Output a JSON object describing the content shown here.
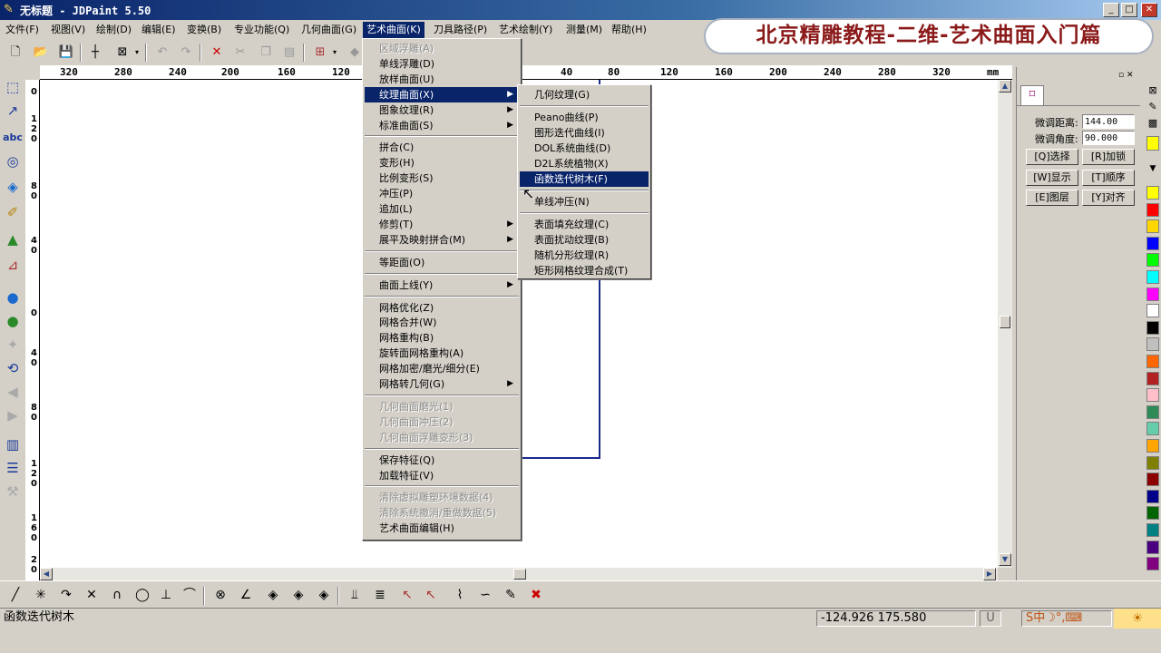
{
  "window": {
    "title": "无标题 - JDPaint 5.50",
    "buttons": {
      "minimize": "_",
      "maximize": "□",
      "close": "✕"
    }
  },
  "menubar": [
    "文件(F)",
    "视图(V)",
    "绘制(D)",
    "编辑(E)",
    "变换(B)",
    "专业功能(Q)",
    "几何曲面(G)",
    "艺术曲面(K)",
    "刀具路径(P)",
    "艺术绘制(Y)",
    "测量(M)",
    "帮助(H)"
  ],
  "banner": "北京精雕教程-二维-艺术曲面入门篇",
  "hruler_labels": [
    "320",
    "280",
    "240",
    "200",
    "160",
    "120",
    "40",
    "80",
    "120",
    "160",
    "200",
    "240",
    "280",
    "320",
    "mm"
  ],
  "vruler_labels": [
    "0",
    "1\n2\n0",
    "8\n0",
    "4\n0",
    "0",
    "4\n0",
    "8\n0",
    "1\n2\n0",
    "1\n6\n0",
    "2\n0"
  ],
  "art_menu": {
    "items": [
      {
        "label": "区域浮雕(A)",
        "disabled": true
      },
      {
        "label": "单线浮雕(D)"
      },
      {
        "label": "放样曲面(U)"
      },
      {
        "label": "纹理曲面(X)",
        "submenu": true,
        "highlight": true
      },
      {
        "label": "图象纹理(R)",
        "submenu": true
      },
      {
        "label": "标准曲面(S)",
        "submenu": true
      },
      {
        "sep": true
      },
      {
        "label": "拼合(C)"
      },
      {
        "label": "变形(H)"
      },
      {
        "label": "比例变形(S)"
      },
      {
        "label": "冲压(P)"
      },
      {
        "label": "追加(L)"
      },
      {
        "label": "修剪(T)",
        "submenu": true
      },
      {
        "label": "展平及映射拼合(M)",
        "submenu": true
      },
      {
        "sep": true
      },
      {
        "label": "等距面(O)"
      },
      {
        "sep": true
      },
      {
        "label": "曲面上线(Y)",
        "submenu": true
      },
      {
        "sep": true
      },
      {
        "label": "网格优化(Z)"
      },
      {
        "label": "网格合并(W)"
      },
      {
        "label": "网格重构(B)"
      },
      {
        "label": "旋转面网格重构(A)"
      },
      {
        "label": "网格加密/磨光/细分(E)"
      },
      {
        "label": "网格转几何(G)",
        "submenu": true
      },
      {
        "sep": true
      },
      {
        "label": "几何曲面磨光(1)",
        "disabled": true
      },
      {
        "label": "几何曲面冲压(2)",
        "disabled": true
      },
      {
        "label": "几何曲面浮雕变形(3)",
        "disabled": true
      },
      {
        "sep": true
      },
      {
        "label": "保存特征(Q)"
      },
      {
        "label": "加载特征(V)"
      },
      {
        "sep": true
      },
      {
        "label": "清除虚拟雕塑环境数据(4)",
        "disabled": true
      },
      {
        "label": "清除系统撤消/重做数据(5)",
        "disabled": true
      },
      {
        "label": "艺术曲面编辑(H)"
      }
    ]
  },
  "texture_submenu": {
    "items": [
      {
        "label": "几何纹理(G)"
      },
      {
        "sep": true
      },
      {
        "label": "Peano曲线(P)"
      },
      {
        "label": "图形迭代曲线(I)"
      },
      {
        "label": "DOL系统曲线(D)"
      },
      {
        "label": "D2L系统植物(X)"
      },
      {
        "label": "函数迭代树木(F)",
        "highlight": true
      },
      {
        "sep": true
      },
      {
        "label": "单线冲压(N)"
      },
      {
        "sep": true
      },
      {
        "label": "表面填充纹理(C)"
      },
      {
        "label": "表面扰动纹理(B)"
      },
      {
        "label": "随机分形纹理(R)"
      },
      {
        "label": "矩形网格纹理合成(T)"
      }
    ]
  },
  "panel": {
    "dist_label": "微调距离:",
    "dist_value": "144.00",
    "angle_label": "微调角度:",
    "angle_value": "90.000",
    "buttons": [
      "[Q]选择",
      "[R]加锁",
      "[W]显示",
      "[T]顺序",
      "[E]图层",
      "[Y]对齐"
    ]
  },
  "palette": [
    "#ffff00",
    "#ff0000",
    "#ffd700",
    "#0000ff",
    "#00ff00",
    "#00ffff",
    "#ff00ff",
    "#ffffff",
    "#000000",
    "#c0c0c0",
    "#ff6600",
    "#b22222",
    "#ffc0cb",
    "#2e8b57",
    "#66cdaa",
    "#ffa500",
    "#808000",
    "#8b0000",
    "#00008b",
    "#006400",
    "#008080",
    "#4b0082",
    "#800080"
  ],
  "status": {
    "message": "函数迭代树木",
    "coords": "-124.926 175.580",
    "mode": "U",
    "ime": "S中☽°,⌨"
  }
}
